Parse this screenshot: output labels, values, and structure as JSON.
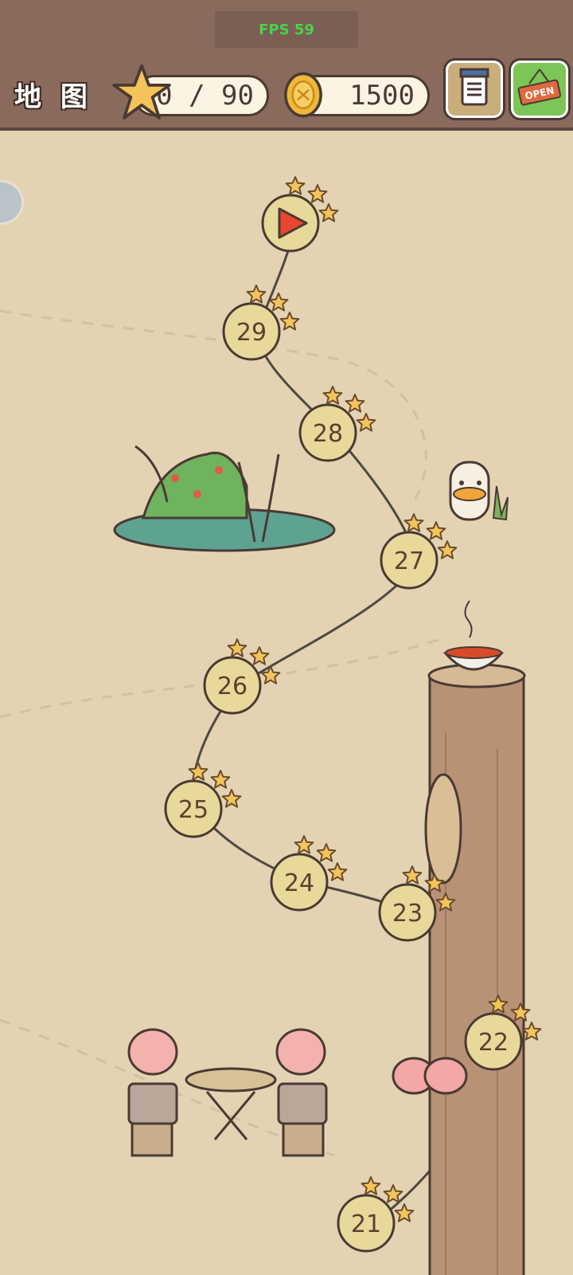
{
  "hud": {
    "fps": "FPS 59",
    "title": "地 图",
    "stars": "90 / 90",
    "coins": "1500",
    "open_sign": "OPEN"
  },
  "levels": [
    {
      "label": "",
      "stars_earned": 3,
      "current": true
    },
    {
      "label": "29",
      "stars_earned": 3
    },
    {
      "label": "28",
      "stars_earned": 3
    },
    {
      "label": "27",
      "stars_earned": 3
    },
    {
      "label": "26",
      "stars_earned": 3
    },
    {
      "label": "25",
      "stars_earned": 3
    },
    {
      "label": "24",
      "stars_earned": 3
    },
    {
      "label": "23",
      "stars_earned": 3
    },
    {
      "label": "22",
      "stars_earned": 3
    },
    {
      "label": "21",
      "stars_earned": 3
    }
  ],
  "colors": {
    "topbar": "#8a6a5d",
    "background": "#e3d3b3",
    "node_fill": "#e7d99a",
    "star": "#f2c45a",
    "fps_text": "#4ad44a"
  }
}
